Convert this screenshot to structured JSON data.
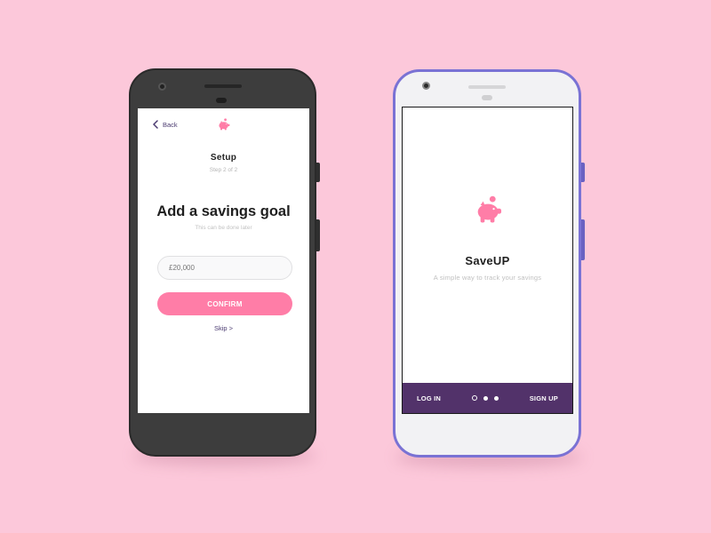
{
  "colors": {
    "background": "#fcc8da",
    "accent_pink": "#ff7da7",
    "brand_purple": "#52326a",
    "left_frame": "#3d3d3d",
    "right_frame_edge": "#7a72d4"
  },
  "setup_screen": {
    "back_label": "Back",
    "back_icon": "chevron-left-icon",
    "logo_icon": "piggy-bank-icon",
    "title": "Setup",
    "step": "Step 2 of 2",
    "heading": "Add a savings goal",
    "subheading": "This can be done later",
    "goal_input": {
      "value": "",
      "placeholder": "£20,000"
    },
    "confirm_label": "CONFIRM",
    "skip_label": "Skip >"
  },
  "welcome_screen": {
    "logo_icon": "piggy-bank-icon",
    "app_name": "SaveUP",
    "tagline": "A simple way to track your savings",
    "login_label": "LOG IN",
    "signup_label": "SIGN UP",
    "pagination": {
      "total": 3,
      "current": 1
    }
  }
}
